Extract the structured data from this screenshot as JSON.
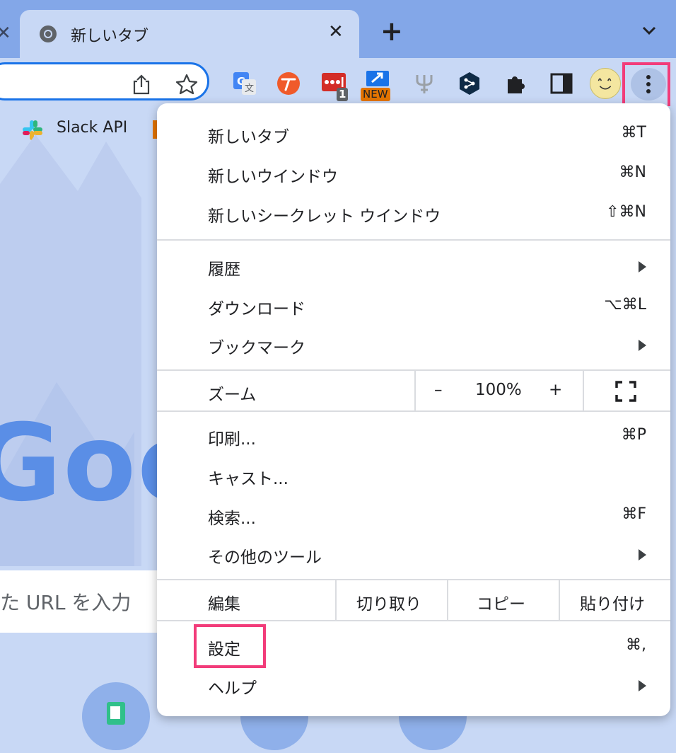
{
  "tab": {
    "title": "新しいタブ"
  },
  "bookmarks": [
    {
      "label": "Slack API"
    }
  ],
  "extensions": [
    {
      "icon": "google-translate-icon"
    },
    {
      "icon": "t-extension-icon"
    },
    {
      "icon": "lastpass-icon",
      "badge": "1"
    },
    {
      "icon": "screenshot-extension-icon",
      "badge": "NEW"
    },
    {
      "icon": "trident-extension-icon"
    },
    {
      "icon": "deepl-icon"
    },
    {
      "icon": "puzzle-icon"
    },
    {
      "icon": "side-panel-icon"
    }
  ],
  "ntp": {
    "logo_partial": "Goo",
    "search_placeholder_partial": "た URL を入力"
  },
  "menu": {
    "group1": [
      {
        "label": "新しいタブ",
        "shortcut": "⌘T"
      },
      {
        "label": "新しいウインドウ",
        "shortcut": "⌘N"
      },
      {
        "label": "新しいシークレット ウインドウ",
        "shortcut": "⇧⌘N"
      }
    ],
    "group2": [
      {
        "label": "履歴",
        "submenu": true
      },
      {
        "label": "ダウンロード",
        "shortcut": "⌥⌘L"
      },
      {
        "label": "ブックマーク",
        "submenu": true
      }
    ],
    "zoom": {
      "label": "ズーム",
      "minus": "–",
      "value": "100%",
      "plus": "+"
    },
    "group3": [
      {
        "label": "印刷...",
        "shortcut": "⌘P"
      },
      {
        "label": "キャスト..."
      },
      {
        "label": "検索...",
        "shortcut": "⌘F"
      },
      {
        "label": "その他のツール",
        "submenu": true
      }
    ],
    "edit": {
      "label": "編集",
      "cut": "切り取り",
      "copy": "コピー",
      "paste": "貼り付け"
    },
    "group4": [
      {
        "label": "設定",
        "shortcut": "⌘,"
      },
      {
        "label": "ヘルプ",
        "submenu": true
      }
    ]
  },
  "colors": {
    "highlight": "#f23c7a",
    "accent": "#1a73e8",
    "tabstrip": "#83a7e8",
    "toolbar": "#c8d8f5"
  }
}
